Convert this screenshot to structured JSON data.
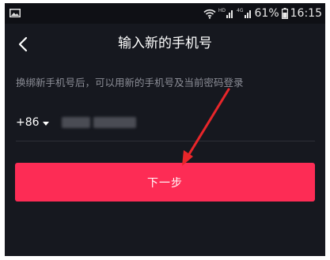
{
  "status_bar": {
    "network_tags": [
      "HD",
      "4G"
    ],
    "battery": "61%",
    "time": "16:15"
  },
  "nav": {
    "title": "输入新的手机号"
  },
  "hint": "换绑新手机号后，可以用新的手机号及当前密码登录",
  "phone": {
    "country_code": "+86"
  },
  "next_button": {
    "label": "下一步"
  },
  "colors": {
    "background": "#16181f",
    "accent": "#fd2c55",
    "annotation": "#e8262a"
  },
  "icons": [
    "gallery-icon",
    "wifi-icon",
    "signal-icon",
    "battery-icon",
    "back-chevron-icon",
    "dropdown-caret-icon"
  ]
}
